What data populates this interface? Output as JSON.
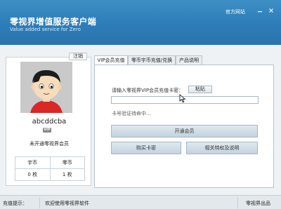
{
  "header": {
    "title": "零视界增值服务客户端",
    "subtitle": "Value added service for Zero",
    "site_link": "官方网站",
    "controls": {
      "minimize_icon": "minimize-icon",
      "close_icon": "close-icon"
    }
  },
  "profile": {
    "logout_label": "注销",
    "username": "abcddcba",
    "vip_badge": "VIP",
    "member_status": "未开通零视界会员",
    "currency": {
      "headers": [
        "宇币",
        "零币"
      ],
      "values": [
        "0 枚",
        "1 枚"
      ]
    }
  },
  "tabs": [
    {
      "label": "VIP会员充值",
      "active": true
    },
    {
      "label": "零币宇币充值/兑换",
      "active": false
    },
    {
      "label": "产品说明",
      "active": false
    }
  ],
  "vip_recharge": {
    "card_label": "请输入零视界VIP会员充值卡密：",
    "paste_label": "粘贴",
    "card_value": "",
    "verify_text": "卡号验证待命中...",
    "open_member_label": "开通会员",
    "buy_card_label": "购买卡密",
    "benefits_label": "相关特权及说明"
  },
  "status_bar": {
    "label": "充值提示：",
    "message": "欢迎使用零视界软件",
    "brand": "零视界出品"
  },
  "colors": {
    "header_blue": "#2f7fba",
    "button_blue": "#c4d3de"
  }
}
